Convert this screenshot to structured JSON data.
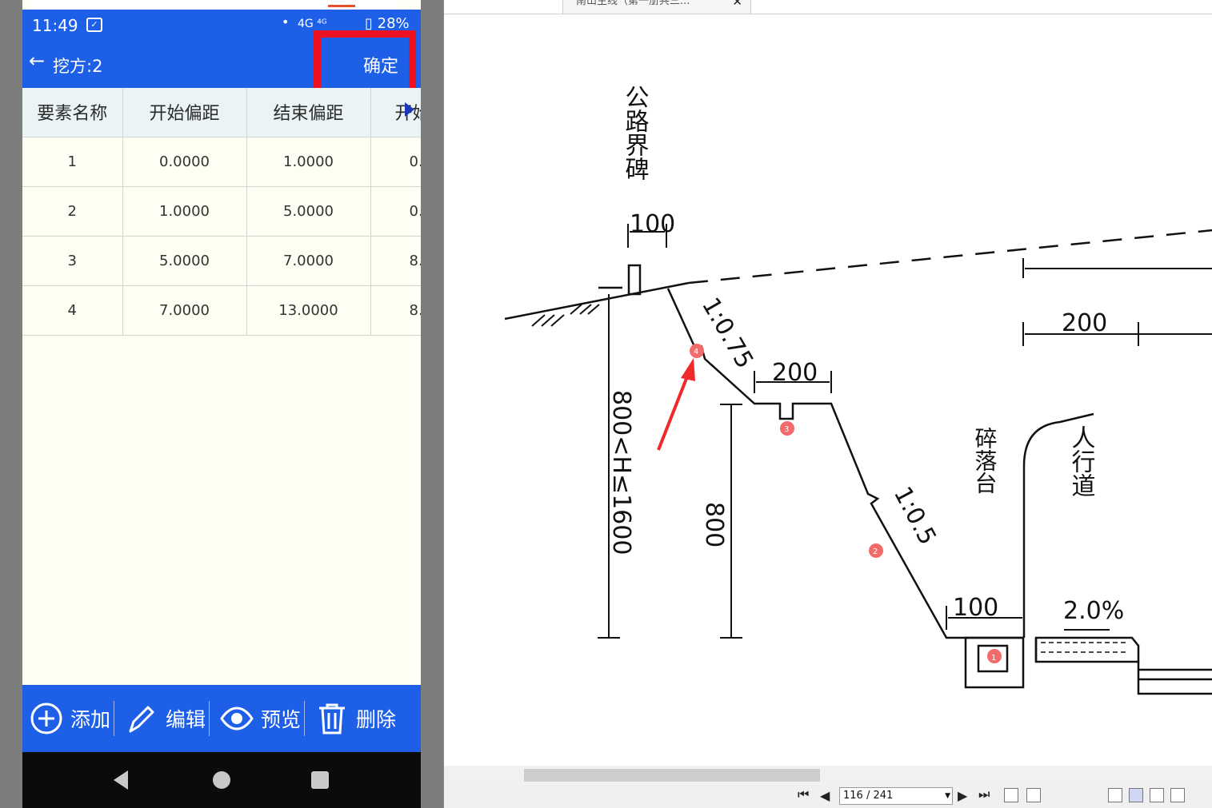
{
  "phone": {
    "status": {
      "time": "11:49",
      "network": "4G ⁴ᴳ",
      "battery": "28%"
    },
    "appbar": {
      "back_icon": "arrow-left-icon",
      "title": "挖方:2",
      "confirm_label": "确定"
    },
    "table": {
      "headers": [
        "要素名称",
        "开始偏距",
        "结束偏距",
        "开始"
      ],
      "rows": [
        [
          "1",
          "0.0000",
          "1.0000",
          "0."
        ],
        [
          "2",
          "1.0000",
          "5.0000",
          "0."
        ],
        [
          "3",
          "5.0000",
          "7.0000",
          "8."
        ],
        [
          "4",
          "7.0000",
          "13.0000",
          "8."
        ]
      ]
    },
    "toolbar": {
      "add": "添加",
      "edit": "编辑",
      "preview": "预览",
      "delete": "删除"
    }
  },
  "viewer": {
    "tab_title": "南山主线（第一册共三...",
    "page_indicator": "116 / 241",
    "drawing": {
      "boundary_marker": "公路界碑",
      "dim_top": "100",
      "slope_upper": "1:0.75",
      "berm_width": "200",
      "height_range": "800<H≤1600",
      "height_800": "800",
      "slope_lower": "1:0.5",
      "platform": "碎落台",
      "ditch_width": "100",
      "crossfall": "2.0%",
      "sidewalk": "人行道",
      "dim_right": "200",
      "markers": [
        "1",
        "2",
        "3",
        "4"
      ]
    }
  }
}
